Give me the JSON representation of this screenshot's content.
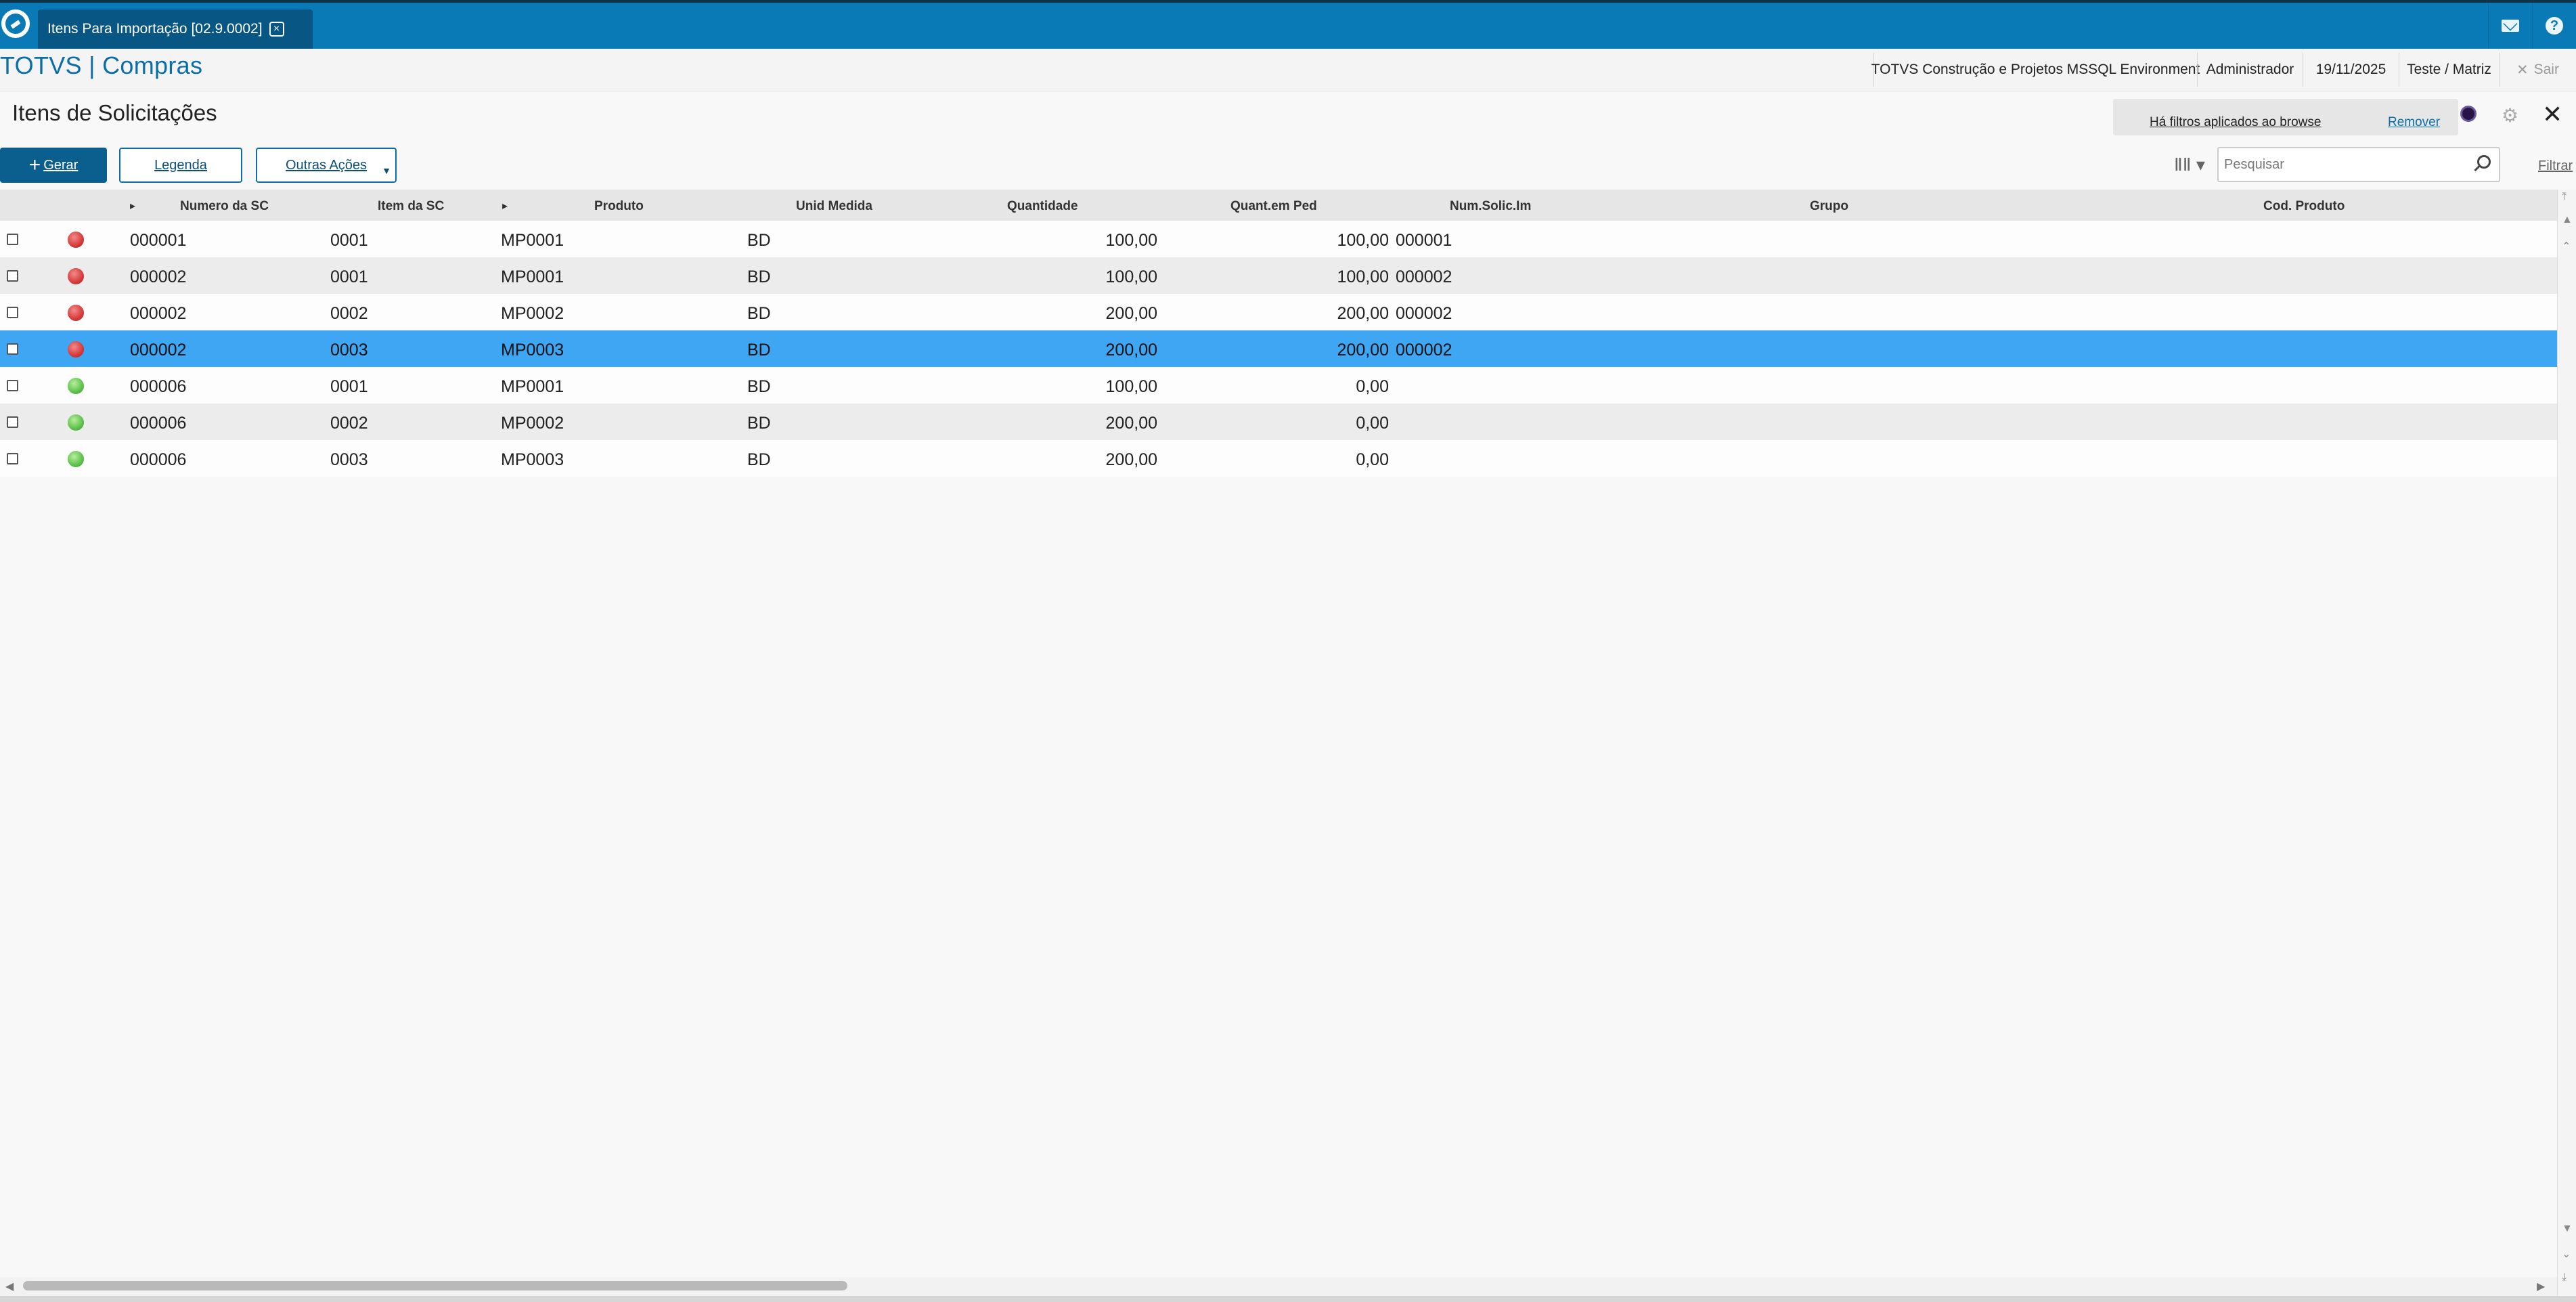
{
  "colors": {
    "header_blue": "#0a7ab6",
    "active_tab": "#075684",
    "primary_button": "#0b5f8f",
    "selected_row": "#3ea6f2",
    "status_red": "#d63a3a",
    "status_green": "#5cc04a"
  },
  "header": {
    "tab_label": "Itens Para Importação [02.9.0002]",
    "tab_close_icon": "close-icon",
    "mail_icon": "envelope-icon",
    "help_icon": "help-icon"
  },
  "appbar": {
    "title": "TOTVS | Compras",
    "environment": "TOTVS Construção e Projetos MSSQL Environment",
    "user": "Administrador",
    "date": "19/11/2025",
    "branch": "Teste / Matriz",
    "exit_label": "Sair"
  },
  "page": {
    "title": "Itens de Solicitações",
    "filter_notice": "Há filtros aplicados ao browse",
    "filter_remove": "Remover"
  },
  "toolbar": {
    "gerar_label": "Gerar",
    "legenda_label": "Legenda",
    "outras_label": "Outras Ações",
    "search_placeholder": "Pesquisar",
    "filtrar_label": "Filtrar"
  },
  "grid": {
    "columns": [
      "Numero da SC",
      "Item da SC",
      "Produto",
      "Unid Medida",
      "Quantidade",
      "Quant.em Ped",
      "Num.Solic.Im",
      "Grupo",
      "Cod. Produto"
    ],
    "rows": [
      {
        "status": "red",
        "numero": "000001",
        "item": "0001",
        "produto": "MP0001",
        "unid": "BD",
        "quantidade": "100,00",
        "quant_ped": "100,00",
        "num_solic": "000001"
      },
      {
        "status": "red",
        "numero": "000002",
        "item": "0001",
        "produto": "MP0001",
        "unid": "BD",
        "quantidade": "100,00",
        "quant_ped": "100,00",
        "num_solic": "000002"
      },
      {
        "status": "red",
        "numero": "000002",
        "item": "0002",
        "produto": "MP0002",
        "unid": "BD",
        "quantidade": "200,00",
        "quant_ped": "200,00",
        "num_solic": "000002"
      },
      {
        "status": "red",
        "numero": "000002",
        "item": "0003",
        "produto": "MP0003",
        "unid": "BD",
        "quantidade": "200,00",
        "quant_ped": "200,00",
        "num_solic": "000002",
        "selected": true
      },
      {
        "status": "green",
        "numero": "000006",
        "item": "0001",
        "produto": "MP0001",
        "unid": "BD",
        "quantidade": "100,00",
        "quant_ped": "0,00",
        "num_solic": ""
      },
      {
        "status": "green",
        "numero": "000006",
        "item": "0002",
        "produto": "MP0002",
        "unid": "BD",
        "quantidade": "200,00",
        "quant_ped": "0,00",
        "num_solic": ""
      },
      {
        "status": "green",
        "numero": "000006",
        "item": "0003",
        "produto": "MP0003",
        "unid": "BD",
        "quantidade": "200,00",
        "quant_ped": "0,00",
        "num_solic": ""
      }
    ]
  }
}
